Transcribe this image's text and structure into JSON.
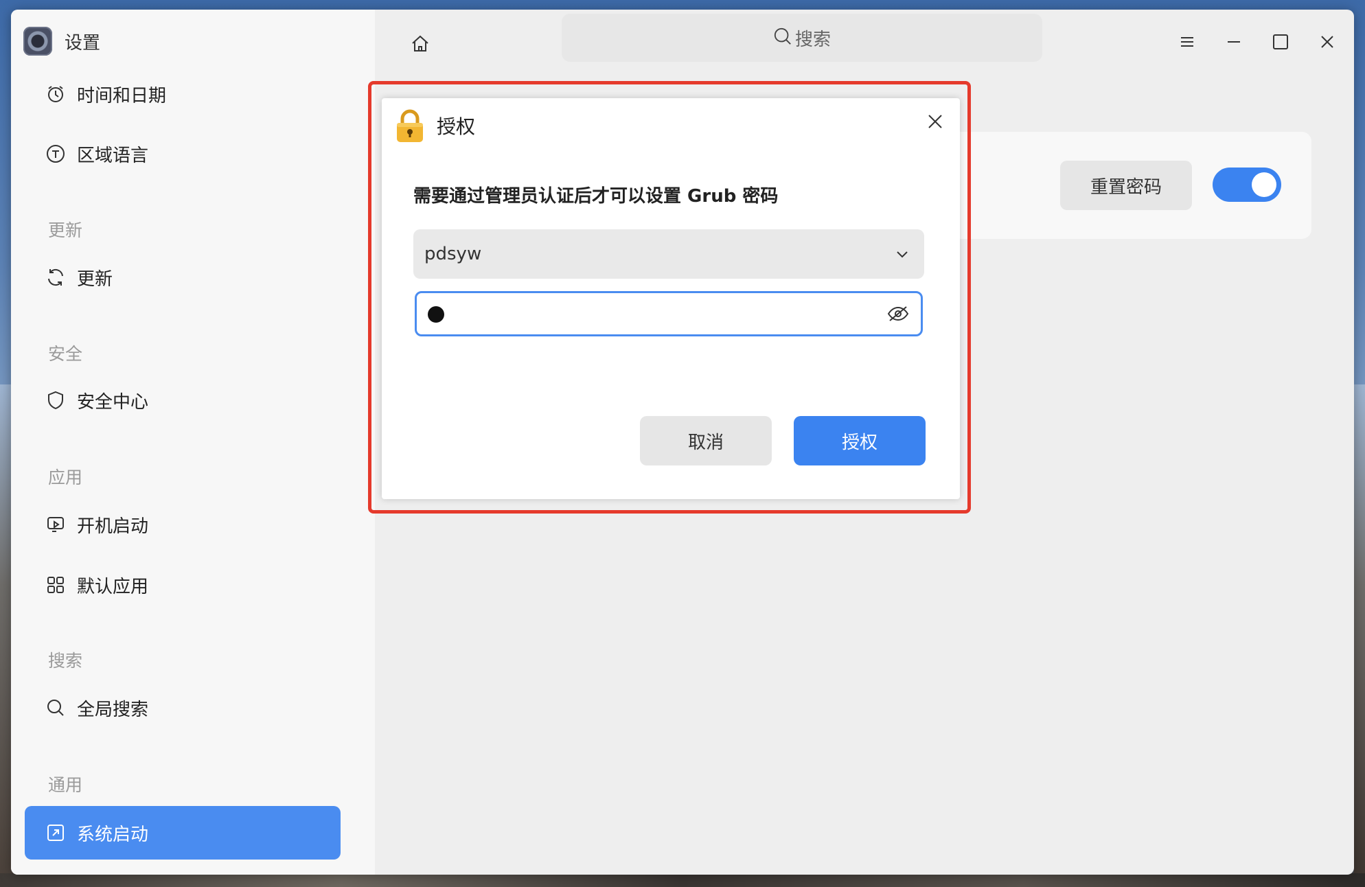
{
  "app": {
    "title": "设置"
  },
  "sidebar": {
    "items": [
      {
        "label": "时间和日期",
        "icon": "clock-icon"
      },
      {
        "label": "区域语言",
        "icon": "language-icon"
      },
      {
        "label": "更新",
        "icon": "refresh-icon"
      },
      {
        "label": "安全中心",
        "icon": "shield-icon"
      },
      {
        "label": "开机启动",
        "icon": "startup-icon"
      },
      {
        "label": "默认应用",
        "icon": "grid-icon"
      },
      {
        "label": "全局搜索",
        "icon": "search-icon"
      },
      {
        "label": "系统启动",
        "icon": "boot-icon",
        "active": true
      }
    ],
    "sections": {
      "update": "更新",
      "security": "安全",
      "apps": "应用",
      "search": "搜索",
      "general": "通用"
    }
  },
  "topbar": {
    "search_placeholder": "搜索"
  },
  "content": {
    "reset_password": "重置密码",
    "toggle_on": true
  },
  "dialog": {
    "title": "授权",
    "message": "需要通过管理员认证后才可以设置 Grub 密码",
    "user": "pdsyw",
    "cancel": "取消",
    "confirm": "授权"
  },
  "colors": {
    "accent": "#3b83f0",
    "highlight": "#e53a2c",
    "sidebar_active": "#4a8cf0"
  }
}
